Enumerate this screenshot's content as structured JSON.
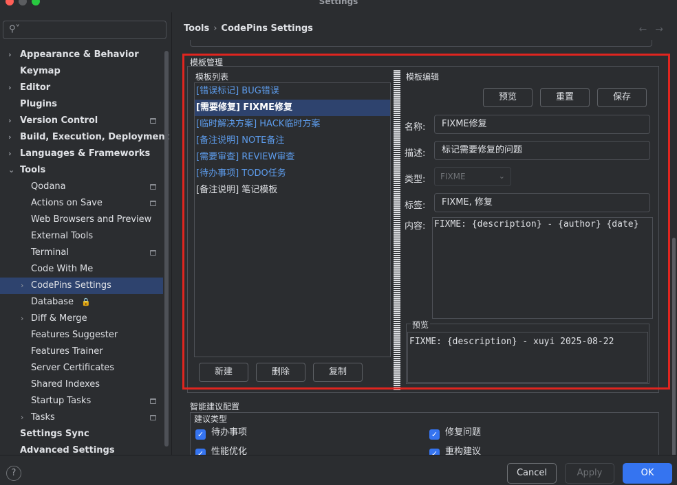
{
  "window": {
    "title": "Settings"
  },
  "search": {
    "placeholder": "",
    "icon": "search-icon"
  },
  "sidebar": {
    "items": [
      {
        "label": "Appearance & Behavior",
        "bold": true,
        "arrow": true,
        "indent": 0
      },
      {
        "label": "Keymap",
        "bold": true,
        "arrow": false,
        "indent": 0
      },
      {
        "label": "Editor",
        "bold": true,
        "arrow": true,
        "indent": 0
      },
      {
        "label": "Plugins",
        "bold": true,
        "arrow": false,
        "indent": 0
      },
      {
        "label": "Version Control",
        "bold": true,
        "arrow": true,
        "indent": 0,
        "badge": true
      },
      {
        "label": "Build, Execution, Deployment",
        "bold": true,
        "arrow": true,
        "indent": 0
      },
      {
        "label": "Languages & Frameworks",
        "bold": true,
        "arrow": true,
        "indent": 0
      },
      {
        "label": "Tools",
        "bold": true,
        "arrow": true,
        "expanded": true,
        "indent": 0
      },
      {
        "label": "Qodana",
        "indent": 1,
        "badge": true
      },
      {
        "label": "Actions on Save",
        "indent": 1,
        "badge": true
      },
      {
        "label": "Web Browsers and Preview",
        "indent": 1
      },
      {
        "label": "External Tools",
        "indent": 1
      },
      {
        "label": "Terminal",
        "indent": 1,
        "badge": true
      },
      {
        "label": "Code With Me",
        "indent": 1
      },
      {
        "label": "CodePins Settings",
        "indent": 1,
        "arrow": true,
        "selected": true
      },
      {
        "label": "Database",
        "indent": 1,
        "lock": true
      },
      {
        "label": "Diff & Merge",
        "indent": 1,
        "arrow": true
      },
      {
        "label": "Features Suggester",
        "indent": 1
      },
      {
        "label": "Features Trainer",
        "indent": 1
      },
      {
        "label": "Server Certificates",
        "indent": 1
      },
      {
        "label": "Shared Indexes",
        "indent": 1
      },
      {
        "label": "Startup Tasks",
        "indent": 1,
        "badge": true
      },
      {
        "label": "Tasks",
        "indent": 1,
        "arrow": true,
        "badge": true
      },
      {
        "label": "Settings Sync",
        "bold": true,
        "indent": 0
      },
      {
        "label": "Advanced Settings",
        "bold": true,
        "indent": 0
      }
    ]
  },
  "breadcrumb": {
    "parent": "Tools",
    "separator": "›",
    "current": "CodePins Settings"
  },
  "nav": {
    "back": "←",
    "forward": "→"
  },
  "template_manager": {
    "title": "模板管理",
    "list_title": "模板列表",
    "items": [
      {
        "label": "[错误标记] BUG错误"
      },
      {
        "label": "[需要修复] FIXME修复",
        "selected": true
      },
      {
        "label": "[临时解决方案] HACK临时方案"
      },
      {
        "label": "[备注说明] NOTE备注"
      },
      {
        "label": "[需要审查] REVIEW审查"
      },
      {
        "label": "[待办事项] TODO任务"
      },
      {
        "label": "[备注说明] 笔记模板",
        "plain": true
      }
    ],
    "buttons": {
      "new": "新建",
      "delete": "删除",
      "copy": "复制"
    }
  },
  "editor": {
    "title": "模板编辑",
    "buttons": {
      "preview": "预览",
      "reset": "重置",
      "save": "保存"
    },
    "name_label": "名称:",
    "name_value": "FIXME修复",
    "desc_label": "描述:",
    "desc_value": "标记需要修复的问题",
    "type_label": "类型:",
    "type_value": "FIXME",
    "tags_label": "标签:",
    "tags_value": "FIXME, 修复",
    "content_label": "内容:",
    "content_value": "FIXME: {description} - {author} {date}",
    "preview_title": "预览",
    "preview_value": "FIXME: {description} - xuyi 2025-08-22"
  },
  "suggestions": {
    "title": "智能建议配置",
    "subtitle": "建议类型",
    "checks": [
      {
        "label": "待办事项",
        "checked": true
      },
      {
        "label": "修复问题",
        "checked": true
      },
      {
        "label": "性能优化",
        "checked": true
      },
      {
        "label": "重构建议",
        "checked": true
      }
    ]
  },
  "footer": {
    "help": "?",
    "cancel": "Cancel",
    "apply": "Apply",
    "ok": "OK"
  },
  "colors": {
    "accent": "#3574f0",
    "selection": "#2e436e",
    "link": "#5d9cec",
    "highlight_frame": "#e0251f"
  }
}
